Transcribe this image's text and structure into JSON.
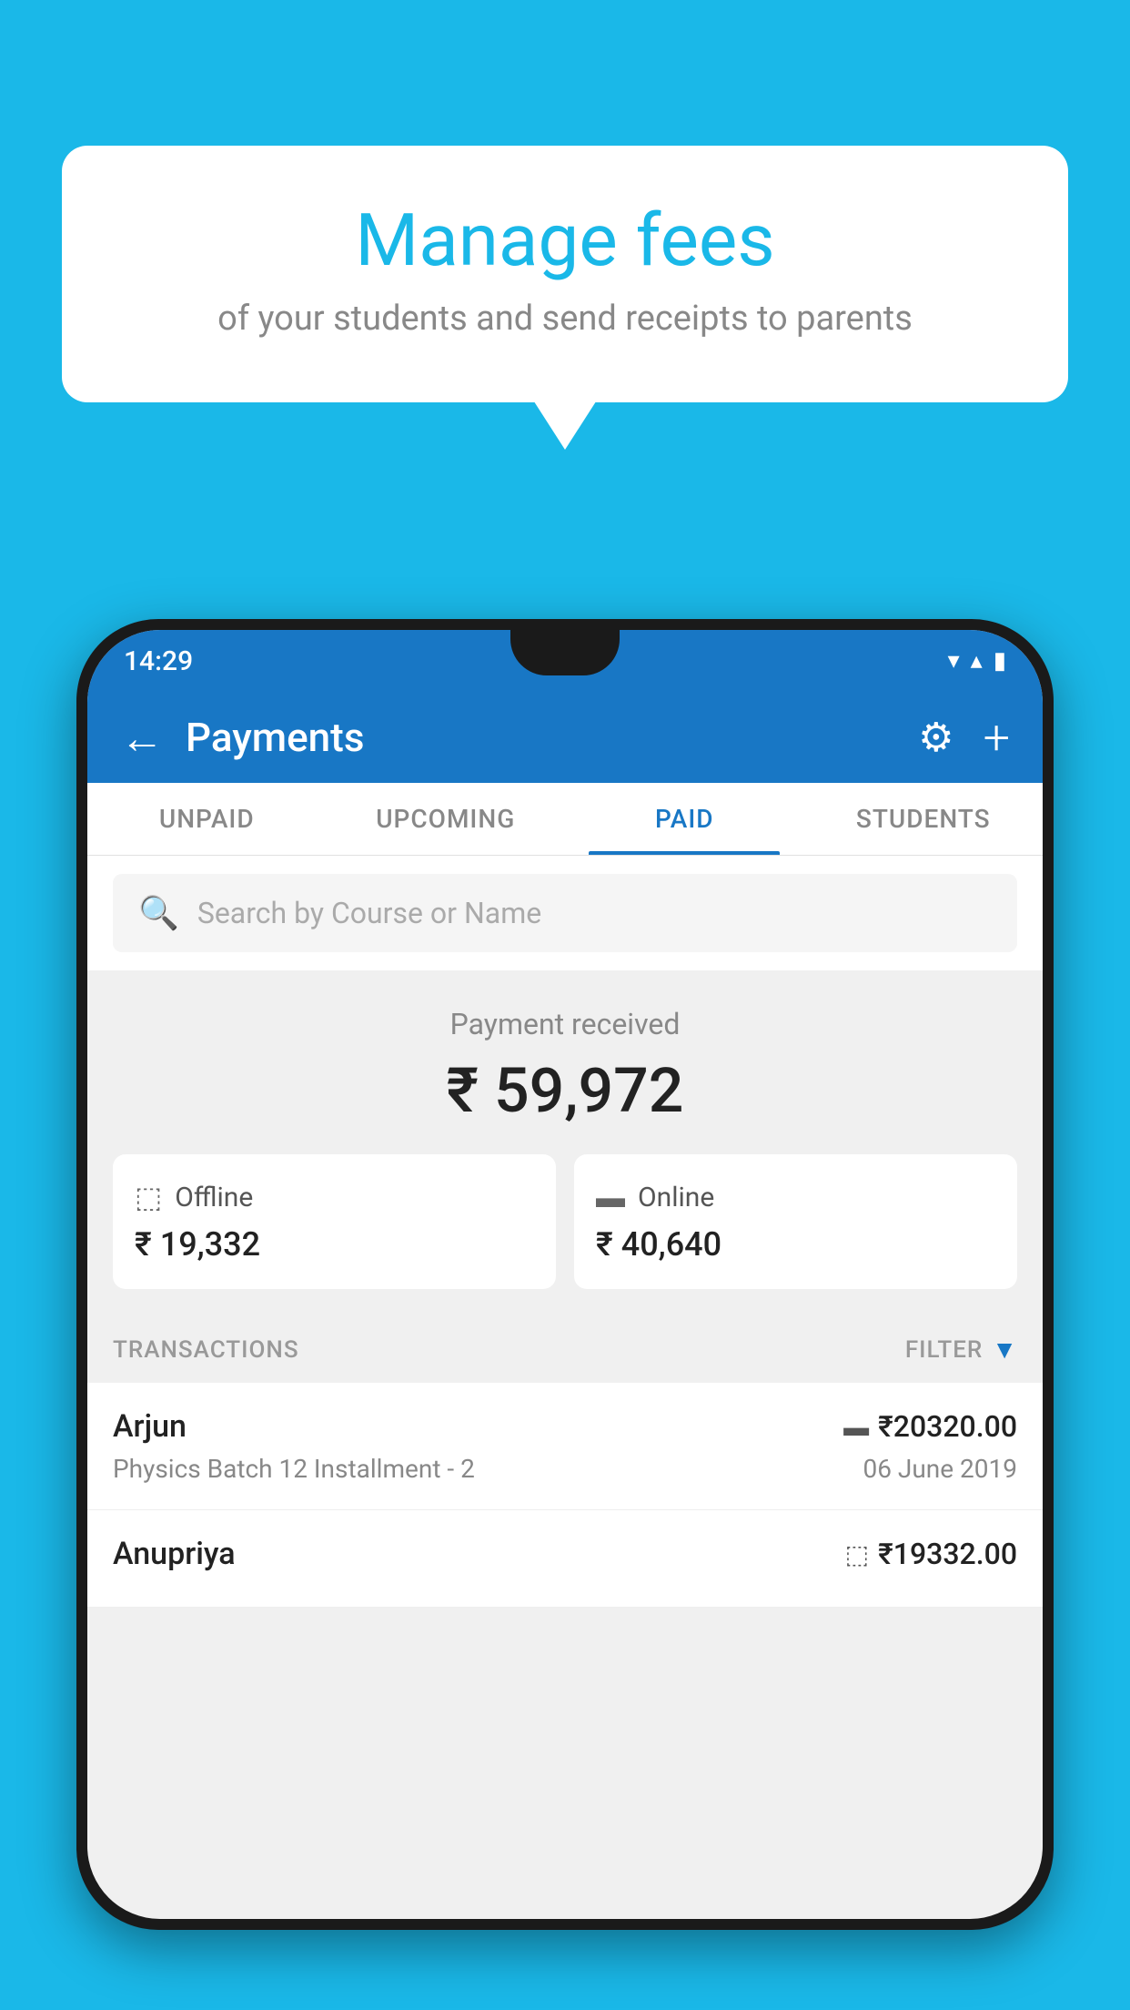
{
  "background_color": "#1ab8e8",
  "bubble": {
    "title": "Manage fees",
    "subtitle": "of your students and send receipts to parents"
  },
  "status_bar": {
    "time": "14:29",
    "wifi_icon": "▼",
    "signal_icon": "▲",
    "battery_icon": "▮"
  },
  "app_bar": {
    "title": "Payments",
    "back_label": "←",
    "gear_label": "⚙",
    "plus_label": "+"
  },
  "tabs": [
    {
      "label": "UNPAID",
      "active": false
    },
    {
      "label": "UPCOMING",
      "active": false
    },
    {
      "label": "PAID",
      "active": true
    },
    {
      "label": "STUDENTS",
      "active": false
    }
  ],
  "search": {
    "placeholder": "Search by Course or Name"
  },
  "payment_received": {
    "label": "Payment received",
    "amount": "₹ 59,972"
  },
  "cards": [
    {
      "type": "Offline",
      "amount": "₹ 19,332",
      "icon": "offline"
    },
    {
      "type": "Online",
      "amount": "₹ 40,640",
      "icon": "online"
    }
  ],
  "transactions_label": "TRANSACTIONS",
  "filter_label": "FILTER",
  "transactions": [
    {
      "name": "Arjun",
      "detail": "Physics Batch 12 Installment - 2",
      "amount": "₹20320.00",
      "date": "06 June 2019",
      "payment_type": "online"
    },
    {
      "name": "Anupriya",
      "detail": "",
      "amount": "₹19332.00",
      "date": "",
      "payment_type": "offline"
    }
  ]
}
